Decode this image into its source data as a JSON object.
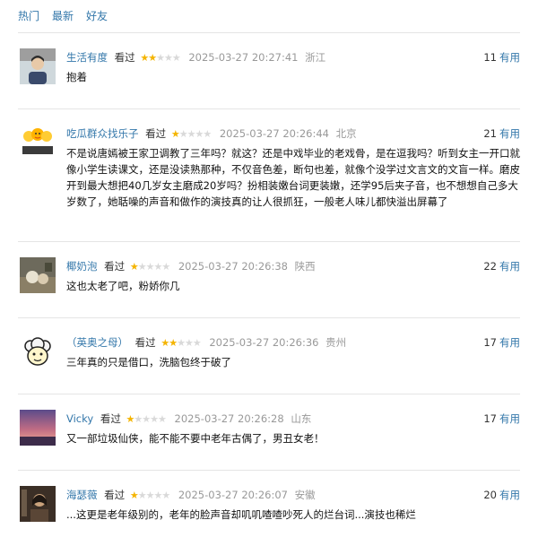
{
  "tabs": [
    "热门",
    "最新",
    "好友"
  ],
  "useful_label": "有用",
  "colors": {
    "link": "#3377aa",
    "star_on": "#f4b400",
    "star_off": "#d9d9d9",
    "meta": "#999999"
  },
  "comments": [
    {
      "user": "生活有度",
      "status": "看过",
      "rating": 2,
      "time": "2025-03-27 20:27:41",
      "location": "浙江",
      "votes": "11",
      "text": "抱着",
      "avatar_icon": "person-photo-avatar"
    },
    {
      "user": "吃瓜群众找乐子",
      "status": "看过",
      "rating": 1,
      "time": "2025-03-27 20:26:44",
      "location": "北京",
      "votes": "21",
      "text": "不是说唐嫣被王家卫调教了三年吗？就这？还是中戏毕业的老戏骨，是在逗我吗？听到女主一开口就像小学生读课文，还是没读熟那种，不仅音色差，断句也差，就像个没学过文言文的文盲一样。磨皮开到最大想把40几岁女主磨成20岁吗？扮相装嫩台词更装嫩，还学95后夹子音，也不想想自己多大岁数了，她聒噪的声音和做作的演技真的让人很抓狂，一般老人味儿都快溢出屏幕了",
      "avatar_icon": "emoji-faces-avatar"
    },
    {
      "user": "椰奶泡",
      "status": "看过",
      "rating": 1,
      "time": "2025-03-27 20:26:38",
      "location": "陕西",
      "votes": "22",
      "text": "这也太老了吧，粉娇你几",
      "avatar_icon": "painting-avatar"
    },
    {
      "user": "（英奥之母）",
      "status": "看过",
      "rating": 2,
      "time": "2025-03-27 20:26:36",
      "location": "贵州",
      "votes": "17",
      "text": "三年真的只是借口，洗脑包终于破了",
      "avatar_icon": "sheep-cartoon-avatar"
    },
    {
      "user": "Vicky",
      "status": "看过",
      "rating": 1,
      "time": "2025-03-27 20:26:28",
      "location": "山东",
      "votes": "17",
      "text": "又一部垃圾仙侠，能不能不要中老年古偶了，男丑女老！",
      "avatar_icon": "sunset-avatar"
    },
    {
      "user": "海瑟薇",
      "status": "看过",
      "rating": 1,
      "time": "2025-03-27 20:26:07",
      "location": "安徽",
      "votes": "20",
      "text": "...这更是老年级别的，老年的脸声音却叽叽喳喳吵死人的烂台词...演技也稀烂",
      "avatar_icon": "dark-photo-avatar"
    }
  ]
}
